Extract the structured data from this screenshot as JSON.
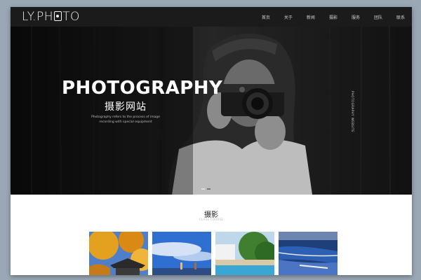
{
  "header": {
    "logo_prefix": "LY.PH",
    "logo_suffix": "TO",
    "nav": [
      "首页",
      "关于",
      "新闻",
      "摄影",
      "服务",
      "团队",
      "联系"
    ]
  },
  "hero": {
    "title": "PHOTOGRAPHY",
    "subtitle": "摄影网站",
    "description": "Photography refers to the process of image recording with special equipment",
    "vertical_text": "PHOTOGRAPHY WEBSITE"
  },
  "section": {
    "title": "摄影",
    "subtitle": "CLASS COURSE"
  },
  "thumbnails": [
    {
      "subject": "autumn-temple"
    },
    {
      "subject": "sky-people"
    },
    {
      "subject": "house-pool"
    },
    {
      "subject": "coastal-city"
    }
  ],
  "colors": {
    "topbar": "#1b1b1b",
    "hero_bg": "#151515",
    "frame_bg": "#9aa7b5"
  }
}
